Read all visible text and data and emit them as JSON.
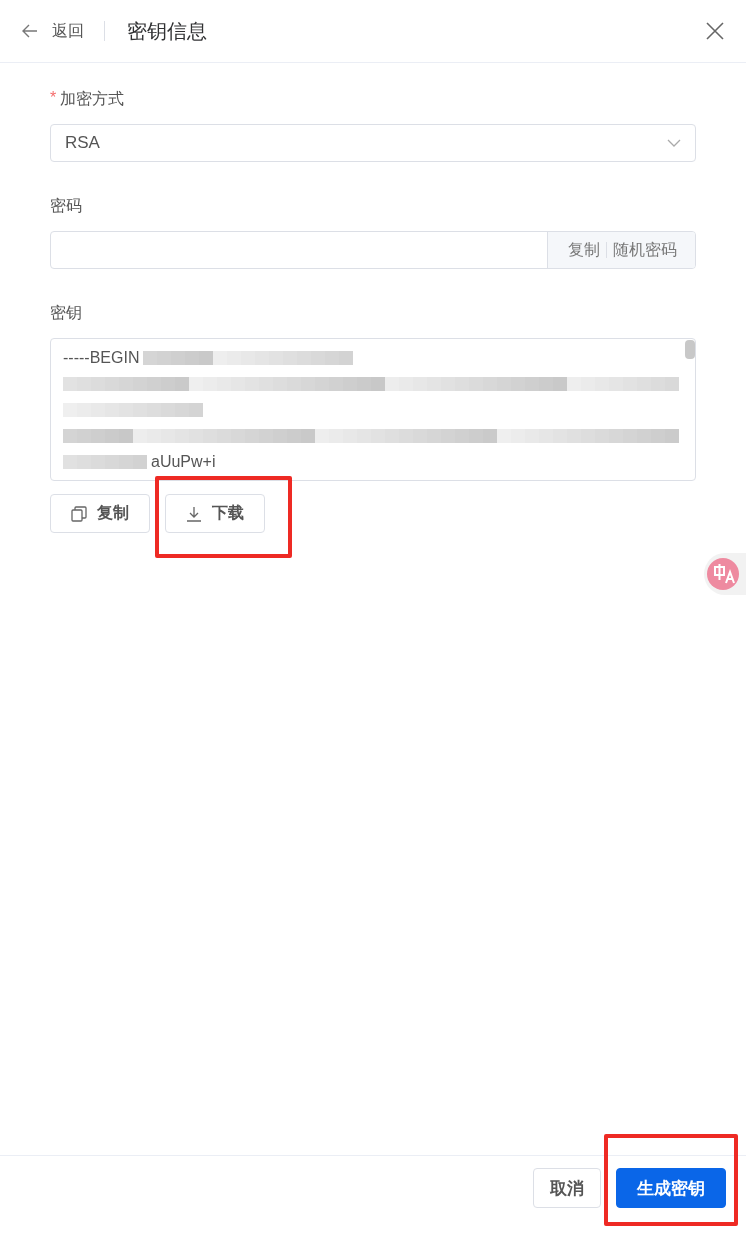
{
  "header": {
    "back_label": "返回",
    "title": "密钥信息"
  },
  "form": {
    "encryption": {
      "label": "加密方式",
      "required_mark": "*",
      "value": "RSA"
    },
    "password": {
      "label": "密码",
      "actions": [
        "复制",
        "随机密码"
      ]
    },
    "key": {
      "label": "密钥",
      "visible_text": [
        "-----BEGIN",
        "aUuPw+i"
      ],
      "actions": [
        {
          "label": "复制",
          "kind": "copy",
          "highlighted": false
        },
        {
          "label": "下载",
          "kind": "download",
          "highlighted": true
        }
      ]
    }
  },
  "footer": {
    "buttons": [
      {
        "label": "取消",
        "kind": "default",
        "highlighted": false
      },
      {
        "label": "生成密钥",
        "kind": "primary",
        "highlighted": true
      }
    ]
  }
}
